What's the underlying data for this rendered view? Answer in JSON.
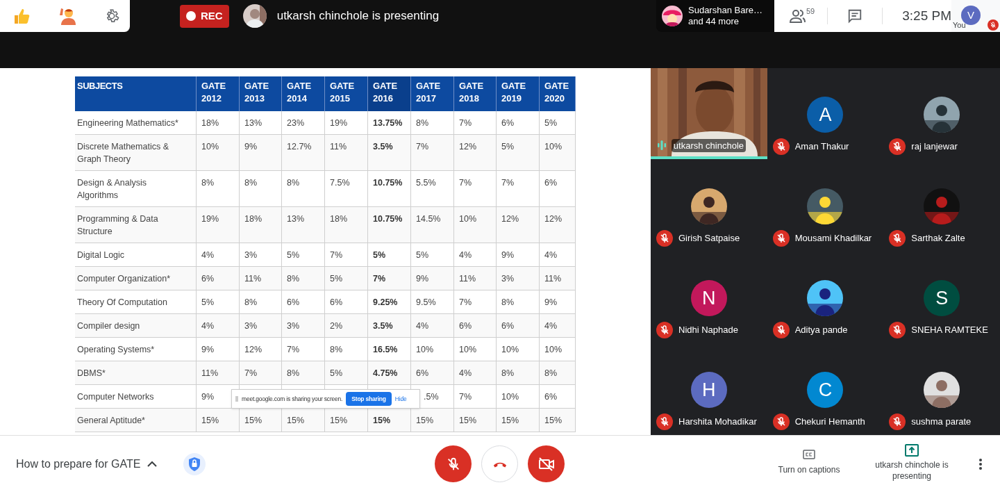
{
  "top_bar": {
    "recording": {
      "label": "REC"
    },
    "presenter_banner": "utkarsh chinchole is presenting",
    "attendee_chip": {
      "name": "Sudarshan Bare…",
      "more": "and 44 more"
    },
    "people_count": "59",
    "time": "3:25 PM",
    "self": {
      "initial": "V",
      "label": "You",
      "muted": true,
      "color": "#5c6bc0"
    }
  },
  "table": {
    "columns": [
      {
        "label": "SUBJECTS",
        "emphasized": false
      },
      {
        "label": "GATE 2012",
        "emphasized": false
      },
      {
        "label": "GATE 2013",
        "emphasized": false
      },
      {
        "label": "GATE 2014",
        "emphasized": false
      },
      {
        "label": "GATE 2015",
        "emphasized": false
      },
      {
        "label": "GATE 2016",
        "emphasized": true
      },
      {
        "label": "GATE 2017",
        "emphasized": false
      },
      {
        "label": "GATE 2018",
        "emphasized": false
      },
      {
        "label": "GATE 2019",
        "emphasized": false
      },
      {
        "label": "GATE 2020",
        "emphasized": false
      }
    ],
    "rows": [
      {
        "cells": [
          "Engineering Mathematics*",
          "18%",
          "13%",
          "23%",
          "19%",
          "13.75%",
          "8%",
          "7%",
          "6%",
          "5%"
        ]
      },
      {
        "cells": [
          "Discrete Mathematics & Graph Theory",
          "10%",
          "9%",
          "12.7%",
          "11%",
          "3.5%",
          "7%",
          "12%",
          "5%",
          "10%"
        ]
      },
      {
        "cells": [
          "Design & Analysis Algorithms",
          "8%",
          "8%",
          "8%",
          "7.5%",
          "10.75%",
          "5.5%",
          "7%",
          "7%",
          "6%"
        ]
      },
      {
        "cells": [
          "Programming & Data Structure",
          "19%",
          "18%",
          "13%",
          "18%",
          "10.75%",
          "14.5%",
          "10%",
          "12%",
          "12%"
        ]
      },
      {
        "cells": [
          "Digital Logic",
          "4%",
          "3%",
          "5%",
          "7%",
          "5%",
          "5%",
          "4%",
          "9%",
          "4%"
        ]
      },
      {
        "cells": [
          "Computer Organization*",
          "6%",
          "11%",
          "8%",
          "5%",
          "7%",
          "9%",
          "11%",
          "3%",
          "11%"
        ]
      },
      {
        "cells": [
          "Theory Of Computation",
          "5%",
          "8%",
          "6%",
          "6%",
          "9.25%",
          "9.5%",
          "7%",
          "8%",
          "9%"
        ]
      },
      {
        "cells": [
          "Compiler design",
          "4%",
          "3%",
          "3%",
          "2%",
          "3.5%",
          "4%",
          "6%",
          "6%",
          "4%"
        ]
      },
      {
        "cells": [
          "Operating Systems*",
          "9%",
          "12%",
          "7%",
          "8%",
          "16.5%",
          "10%",
          "10%",
          "10%",
          "10%"
        ]
      },
      {
        "cells": [
          "DBMS*",
          "11%",
          "7%",
          "8%",
          "5%",
          "4.75%",
          "6%",
          "4%",
          "8%",
          "8%"
        ]
      },
      {
        "cells": [
          "Computer Networks",
          "9%",
          null,
          null,
          null,
          null,
          ".5%",
          "7%",
          "10%",
          "6%"
        ]
      },
      {
        "cells": [
          "General Aptitude*",
          "15%",
          "15%",
          "15%",
          "15%",
          "15%",
          "15%",
          "15%",
          "15%",
          "15%"
        ]
      }
    ]
  },
  "share_popup": {
    "text": "meet.google.com is sharing your screen.",
    "stop": "Stop sharing",
    "hide": "Hide"
  },
  "participants": [
    {
      "name": "utkarsh chinchole",
      "kind": "video",
      "muted": false
    },
    {
      "name": "Aman Thakur",
      "kind": "initial",
      "initial": "A",
      "color": "#0b5ea8",
      "muted": true
    },
    {
      "name": "raj lanjewar",
      "muted": true
    },
    {
      "name": "Girish Satpaise",
      "muted": true
    },
    {
      "name": "Mousami Khadilkar",
      "muted": true
    },
    {
      "name": "Sarthak Zalte",
      "muted": true
    },
    {
      "name": "Nidhi Naphade",
      "kind": "initial",
      "initial": "N",
      "color": "#c2185b",
      "muted": true
    },
    {
      "name": "Aditya pande",
      "muted": true
    },
    {
      "name": "SNEHA RAMTEKE",
      "kind": "initial",
      "initial": "S",
      "color": "#004d40",
      "muted": true
    },
    {
      "name": "Harshita Mohadikar",
      "kind": "initial",
      "initial": "H",
      "color": "#5c6bc0",
      "muted": true
    },
    {
      "name": "Chekuri Hemanth",
      "kind": "initial",
      "initial": "C",
      "color": "#0288d1",
      "muted": true
    },
    {
      "name": "sushma parate",
      "muted": true
    }
  ],
  "bottom_bar": {
    "meeting_title": "How to prepare for GATE",
    "mic_muted": true,
    "camera_off": true,
    "captions": "Turn on captions",
    "presenting": "utkarsh chinchole is presenting"
  }
}
